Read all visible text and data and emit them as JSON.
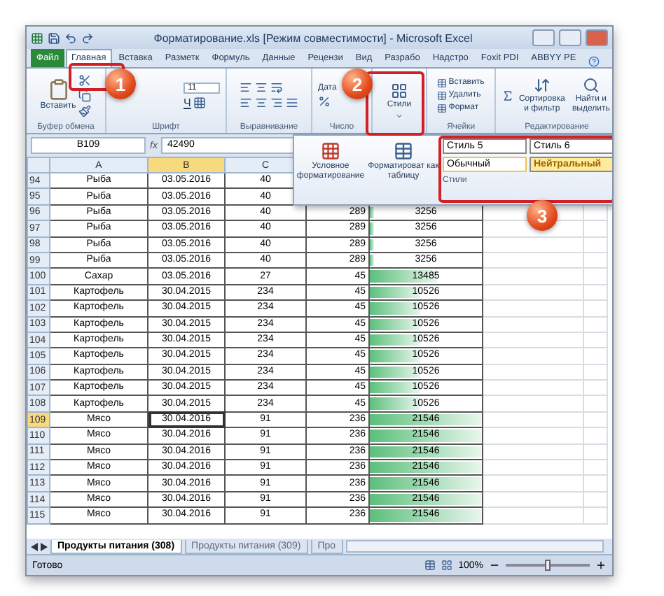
{
  "window": {
    "title": "Форматирование.xls [Режим совместимости] - Microsoft Excel"
  },
  "ribbon_tabs": [
    {
      "label": "Файл",
      "kind": "file",
      "selected": false
    },
    {
      "label": "Главная",
      "kind": "tab",
      "selected": true
    },
    {
      "label": "Вставка",
      "kind": "tab",
      "selected": false
    },
    {
      "label": "Разметк",
      "kind": "tab",
      "selected": false
    },
    {
      "label": "Формуль",
      "kind": "tab",
      "selected": false
    },
    {
      "label": "Данные",
      "kind": "tab",
      "selected": false
    },
    {
      "label": "Рецензи",
      "kind": "tab",
      "selected": false
    },
    {
      "label": "Вид",
      "kind": "tab",
      "selected": false
    },
    {
      "label": "Разрабо",
      "kind": "tab",
      "selected": false
    },
    {
      "label": "Надстро",
      "kind": "tab",
      "selected": false
    },
    {
      "label": "Foxit PDI",
      "kind": "tab",
      "selected": false
    },
    {
      "label": "ABBYY PE",
      "kind": "tab",
      "selected": false
    }
  ],
  "ribbon": {
    "clipboard": {
      "paste": "Вставить",
      "label": "Буфер обмена"
    },
    "font": {
      "size": "11",
      "underline": "Ч",
      "label": "Шрифт"
    },
    "alignment": {
      "label": "Выравнивание"
    },
    "number": {
      "format": "Дата",
      "label": "Число"
    },
    "styles": {
      "button": "Стили"
    },
    "cells": {
      "buttons": [
        "Вставить",
        "Удалить",
        "Формат"
      ],
      "label": "Ячейки"
    },
    "editing": {
      "buttons": [
        "Сортировка и фильтр",
        "Найти и выделить"
      ],
      "label": "Редактирование"
    }
  },
  "formula_bar": {
    "name_box": "B109",
    "fx": "fx",
    "value": "42490"
  },
  "styles_popup": {
    "buttons": [
      "Условное форматирование",
      "Форматироват как таблицу"
    ],
    "styles": [
      {
        "label": "Стиль 5",
        "kind": "plain"
      },
      {
        "label": "Стиль 6",
        "kind": "plain"
      },
      {
        "label": "Обычный",
        "kind": "normal"
      },
      {
        "label": "Нейтральный",
        "kind": "neutral"
      }
    ],
    "label": "Стили"
  },
  "columns": [
    {
      "label": "A",
      "selected": false
    },
    {
      "label": "B",
      "selected": true
    },
    {
      "label": "C",
      "selected": false
    }
  ],
  "rows": [
    {
      "num": "94",
      "a": "Рыба",
      "b": "03.05.2016",
      "c": "40",
      "selected": false
    },
    {
      "num": "95",
      "a": "Рыба",
      "b": "03.05.2016",
      "c": "40",
      "selected": false
    },
    {
      "num": "96",
      "a": "Рыба",
      "b": "03.05.2016",
      "c": "40",
      "d": "289",
      "e": "3256",
      "level": 0.04,
      "selected": false
    },
    {
      "num": "97",
      "a": "Рыба",
      "b": "03.05.2016",
      "c": "40",
      "d": "289",
      "e": "3256",
      "level": 0.04,
      "selected": false
    },
    {
      "num": "98",
      "a": "Рыба",
      "b": "03.05.2016",
      "c": "40",
      "d": "289",
      "e": "3256",
      "level": 0.04,
      "selected": false
    },
    {
      "num": "99",
      "a": "Рыба",
      "b": "03.05.2016",
      "c": "40",
      "d": "289",
      "e": "3256",
      "level": 0.04,
      "selected": false
    },
    {
      "num": "100",
      "a": "Сахар",
      "b": "03.05.2016",
      "c": "27",
      "d": "45",
      "e": "13485",
      "level": 0.6,
      "selected": false
    },
    {
      "num": "101",
      "a": "Картофель",
      "b": "30.04.2015",
      "c": "234",
      "d": "45",
      "e": "10526",
      "level": 0.45,
      "selected": false
    },
    {
      "num": "102",
      "a": "Картофель",
      "b": "30.04.2015",
      "c": "234",
      "d": "45",
      "e": "10526",
      "level": 0.45,
      "selected": false
    },
    {
      "num": "103",
      "a": "Картофель",
      "b": "30.04.2015",
      "c": "234",
      "d": "45",
      "e": "10526",
      "level": 0.45,
      "selected": false
    },
    {
      "num": "104",
      "a": "Картофель",
      "b": "30.04.2015",
      "c": "234",
      "d": "45",
      "e": "10526",
      "level": 0.45,
      "selected": false
    },
    {
      "num": "105",
      "a": "Картофель",
      "b": "30.04.2015",
      "c": "234",
      "d": "45",
      "e": "10526",
      "level": 0.45,
      "selected": false
    },
    {
      "num": "106",
      "a": "Картофель",
      "b": "30.04.2015",
      "c": "234",
      "d": "45",
      "e": "10526",
      "level": 0.45,
      "selected": false
    },
    {
      "num": "107",
      "a": "Картофель",
      "b": "30.04.2015",
      "c": "234",
      "d": "45",
      "e": "10526",
      "level": 0.45,
      "selected": false
    },
    {
      "num": "108",
      "a": "Картофель",
      "b": "30.04.2015",
      "c": "234",
      "d": "45",
      "e": "10526",
      "level": 0.45,
      "selected": false
    },
    {
      "num": "109",
      "a": "Мясо",
      "b": "30.04.2016",
      "c": "91",
      "d": "236",
      "e": "21546",
      "level": 1,
      "selected": true
    },
    {
      "num": "110",
      "a": "Мясо",
      "b": "30.04.2016",
      "c": "91",
      "d": "236",
      "e": "21546",
      "level": 1,
      "selected": false
    },
    {
      "num": "111",
      "a": "Мясо",
      "b": "30.04.2016",
      "c": "91",
      "d": "236",
      "e": "21546",
      "level": 1,
      "selected": false
    },
    {
      "num": "112",
      "a": "Мясо",
      "b": "30.04.2016",
      "c": "91",
      "d": "236",
      "e": "21546",
      "level": 1,
      "selected": false
    },
    {
      "num": "113",
      "a": "Мясо",
      "b": "30.04.2016",
      "c": "91",
      "d": "236",
      "e": "21546",
      "level": 1,
      "selected": false
    },
    {
      "num": "114",
      "a": "Мясо",
      "b": "30.04.2016",
      "c": "91",
      "d": "236",
      "e": "21546",
      "level": 1,
      "selected": false
    },
    {
      "num": "115",
      "a": "Мясо",
      "b": "30.04.2016",
      "c": "91",
      "d": "236",
      "e": "21546",
      "level": 1,
      "selected": false
    }
  ],
  "sheet_tabs": [
    {
      "label": "Продукты питания (308)",
      "selected": true
    },
    {
      "label": "Продукты питания (309)",
      "selected": false
    },
    {
      "label": "Про",
      "selected": false
    }
  ],
  "status_bar": {
    "status": "Готово",
    "zoom": "100%",
    "level": 0.5
  },
  "callouts": [
    "1",
    "2",
    "3"
  ]
}
